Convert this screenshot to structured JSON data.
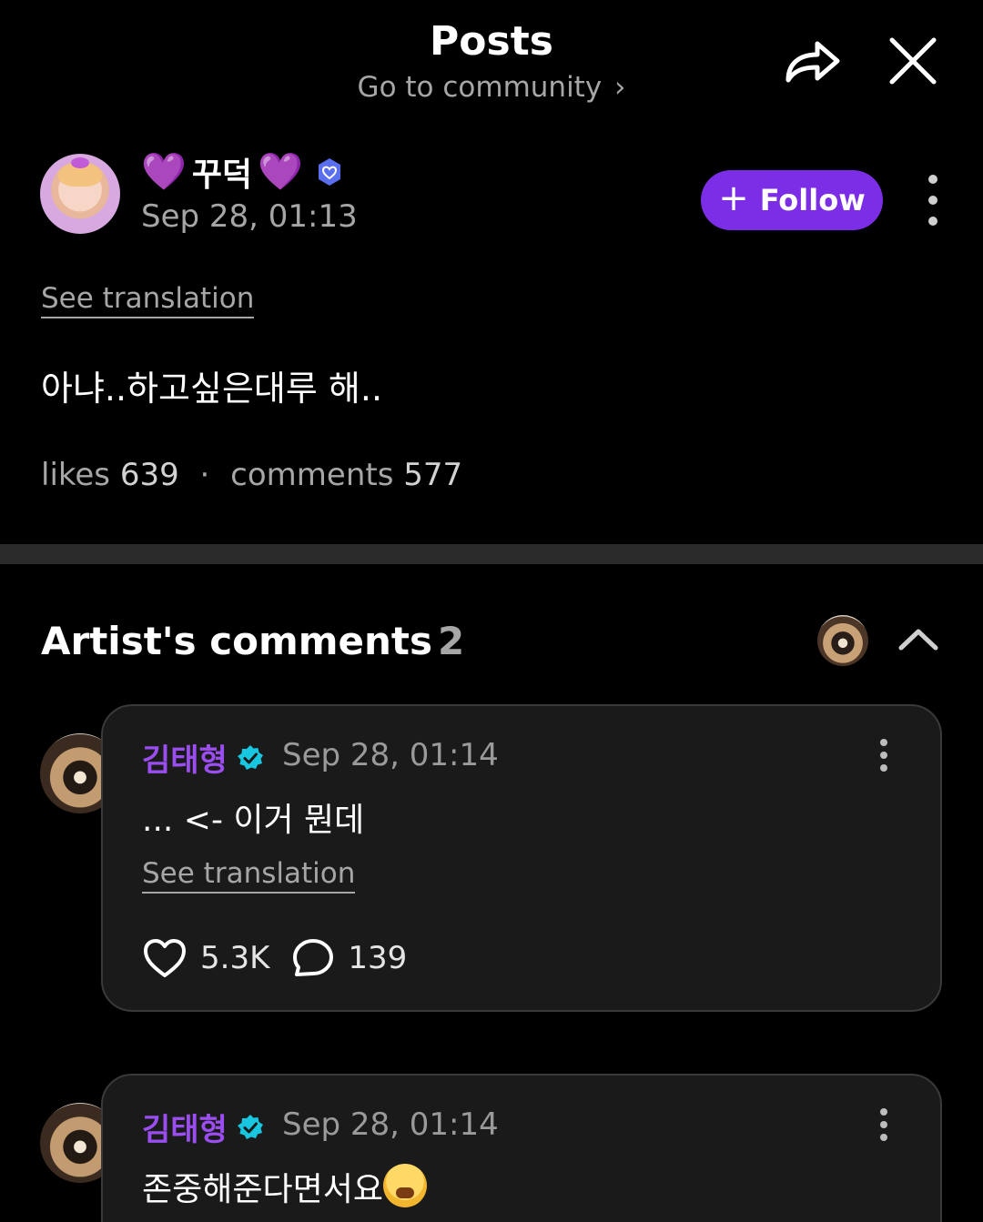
{
  "header": {
    "title": "Posts",
    "community_link": "Go to community",
    "community_chevron": "›",
    "share_icon": "share-arrow-icon",
    "close_icon": "close-icon"
  },
  "post": {
    "author": {
      "heart_left": "💜",
      "name": "꾸덕",
      "heart_right": "💜",
      "badge_icon": "verified-heart-badge-icon"
    },
    "date": "Sep 28, 01:13",
    "follow_label": "Follow",
    "follow_plus": "+",
    "see_translation": "See translation",
    "body": "아냐..하고싶은대루 해..",
    "stats": {
      "likes_label": "likes",
      "likes_value": "639",
      "separator": "·",
      "comments_label": "comments",
      "comments_value": "577"
    }
  },
  "artist_comments": {
    "title": "Artist's comments",
    "count": "2",
    "comments": [
      {
        "author": "김태형",
        "date": "Sep 28, 01:14",
        "text": "... <- 이거 뭔데",
        "see_translation": "See translation",
        "likes": "5.3K",
        "replies": "139"
      },
      {
        "author": "김태형",
        "date": "Sep 28, 01:14",
        "text": "존중해준다면서요"
      }
    ]
  },
  "colors": {
    "accent": "#7c2ee6",
    "artist_name": "#9a4df0",
    "muted": "#a6a6a6",
    "card_bg": "#1a1a1a",
    "verified_check": "#18c6e0"
  }
}
